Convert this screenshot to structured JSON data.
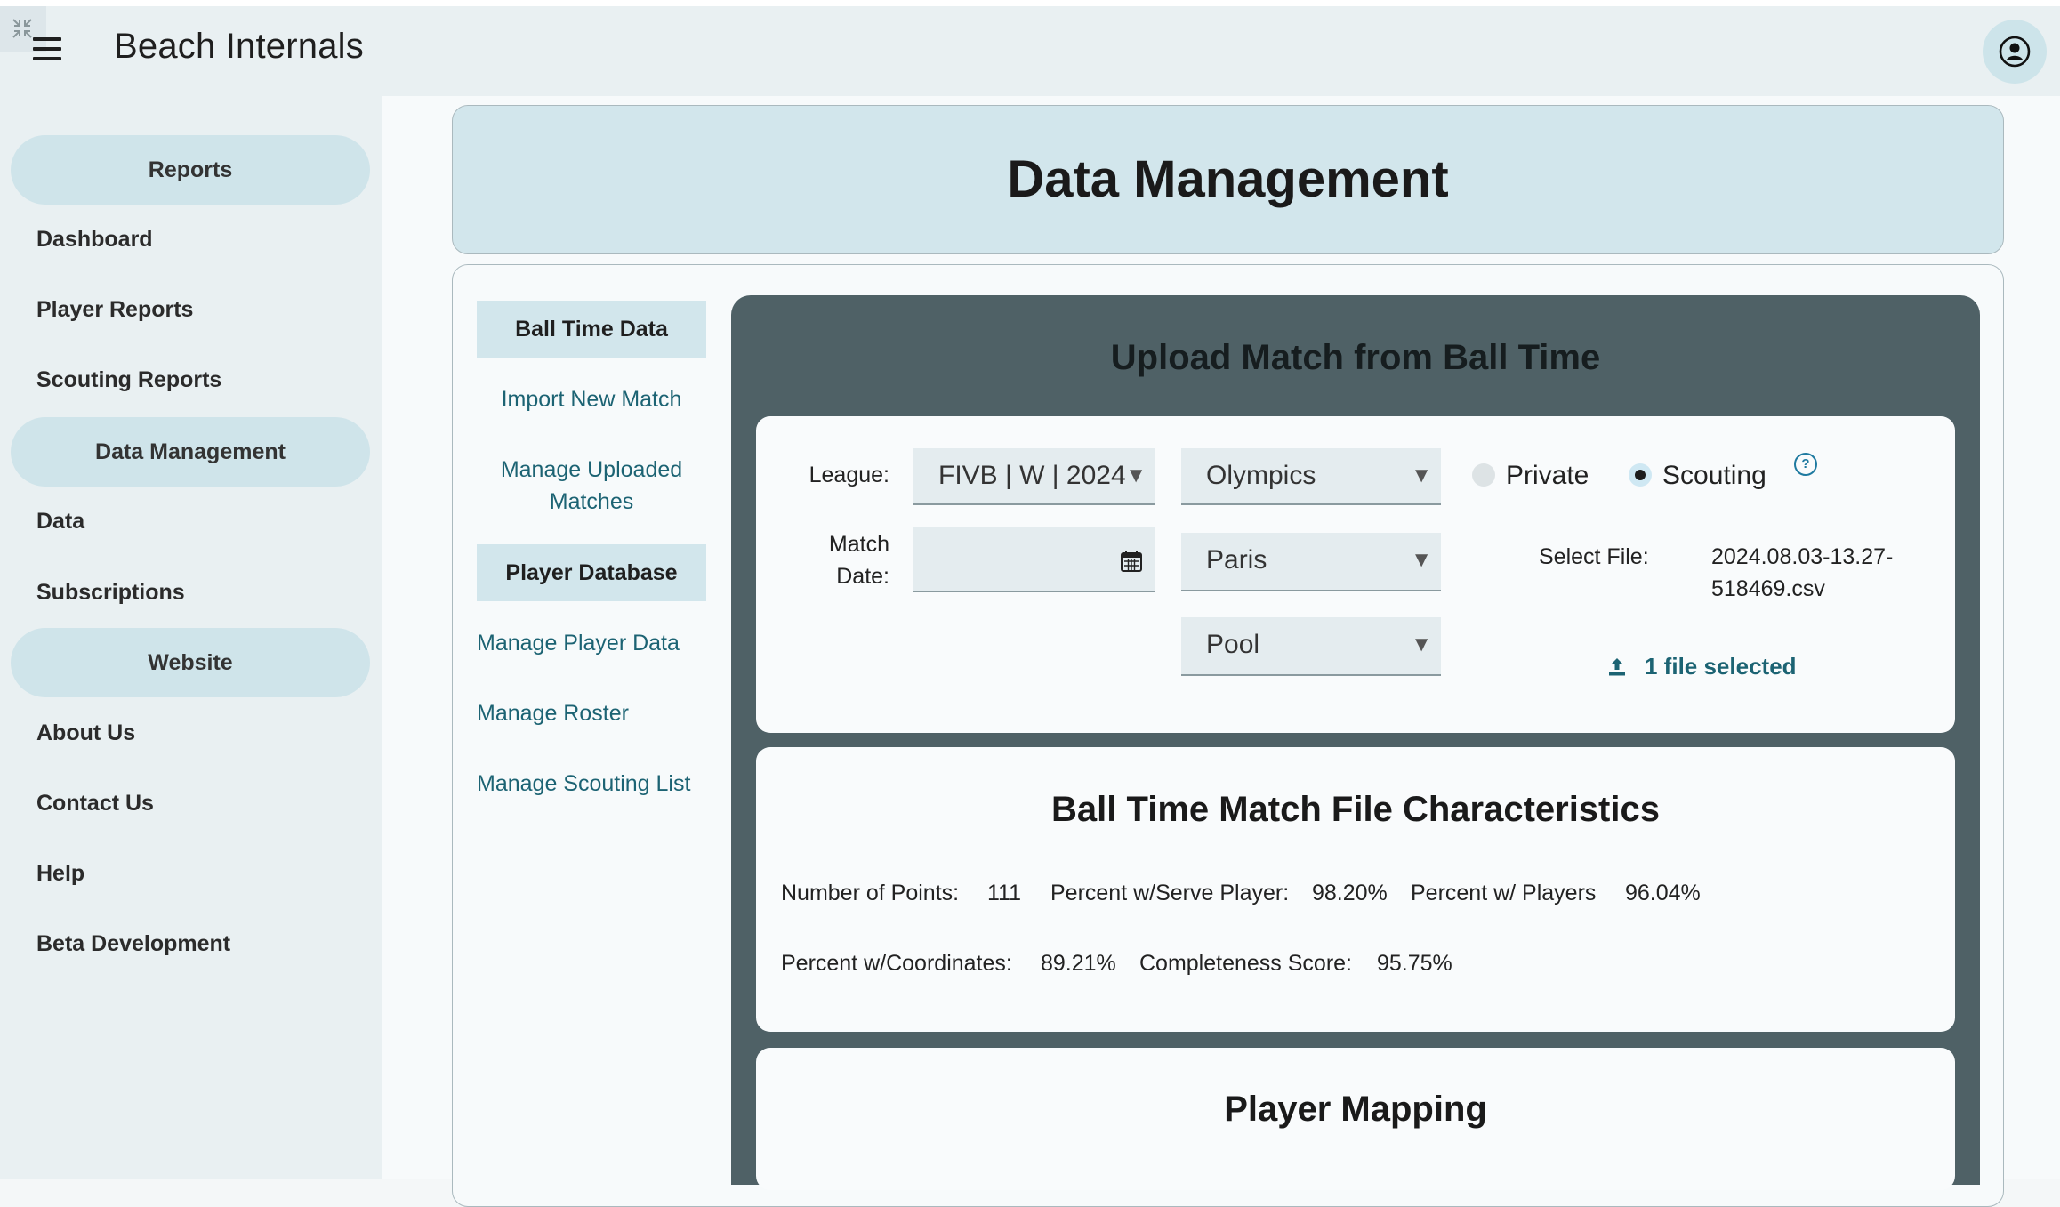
{
  "app": {
    "title": "Beach Internals"
  },
  "sidebar": {
    "sections": [
      {
        "label": "Reports",
        "items": [
          "Dashboard",
          "Player Reports",
          "Scouting Reports"
        ]
      },
      {
        "label": "Data Management",
        "items": [
          "Data",
          "Subscriptions"
        ]
      },
      {
        "label": "Website",
        "items": [
          "About Us",
          "Contact Us",
          "Help",
          "Beta Development"
        ]
      }
    ]
  },
  "page": {
    "title": "Data Management"
  },
  "subnav": {
    "ball_time": {
      "label": "Ball Time Data",
      "links": [
        "Import New Match",
        "Manage Uploaded Matches"
      ]
    },
    "player_db": {
      "label": "Player Database",
      "links": [
        "Manage Player Data",
        "Manage Roster",
        "Manage Scouting List"
      ]
    }
  },
  "upload": {
    "title": "Upload Match from Ball Time",
    "league_label": "League:",
    "league_value": "FIVB | W | 2024",
    "event_value": "Olympics",
    "city_value": "Paris",
    "round_value": "Pool",
    "match_date_label": "Match Date:",
    "match_date_value": "",
    "radio_private": "Private",
    "radio_scouting": "Scouting",
    "selected_radio": "Scouting",
    "select_file_label": "Select File:",
    "file_name": "2024.08.03-13.27-518469.csv",
    "upload_status": "1 file selected"
  },
  "characteristics": {
    "title": "Ball Time Match File Characteristics",
    "stats": [
      {
        "label": "Number of Points:",
        "value": "111"
      },
      {
        "label": "Percent w/Serve Player:",
        "value": "98.20%"
      },
      {
        "label": "Percent w/ Players",
        "value": "96.04%"
      },
      {
        "label": "Percent w/Coordinates:",
        "value": "89.21%"
      },
      {
        "label": "Completeness Score:",
        "value": "95.75%"
      }
    ]
  },
  "mapping": {
    "title": "Player Mapping"
  },
  "icons": [
    "collapse-icon",
    "hamburger-menu-icon",
    "user-account-icon",
    "calendar-icon",
    "help-circle-icon",
    "upload-icon",
    "dropdown-arrow-icon"
  ],
  "colors": {
    "accent": "#cfe4ea",
    "panel": "#4f6166",
    "link": "#1c6373"
  }
}
